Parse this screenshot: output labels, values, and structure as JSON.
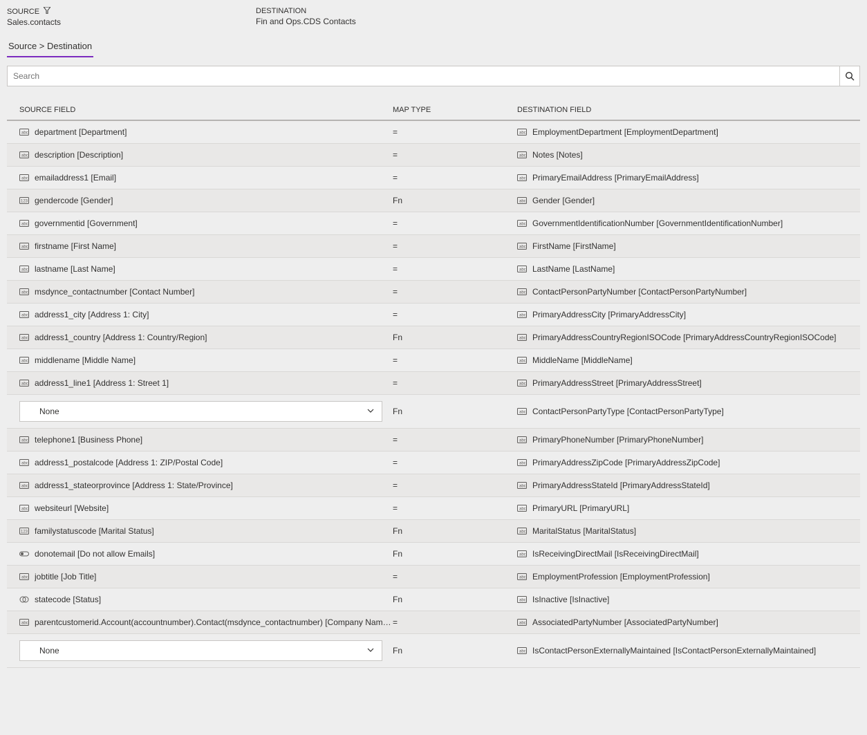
{
  "header": {
    "source_label": "SOURCE",
    "source_value": "Sales.contacts",
    "dest_label": "DESTINATION",
    "dest_value": "Fin and Ops.CDS Contacts"
  },
  "tab": {
    "label": "Source > Destination"
  },
  "search": {
    "placeholder": "Search"
  },
  "columns": {
    "source": "SOURCE FIELD",
    "map": "MAP TYPE",
    "dest": "DESTINATION FIELD"
  },
  "none_label": "None",
  "rows": [
    {
      "src_icon": "field",
      "src": "department [Department]",
      "map": "=",
      "dst_icon": "field",
      "dst": "EmploymentDepartment [EmploymentDepartment]"
    },
    {
      "src_icon": "field",
      "src": "description [Description]",
      "map": "=",
      "dst_icon": "field",
      "dst": "Notes [Notes]"
    },
    {
      "src_icon": "field",
      "src": "emailaddress1 [Email]",
      "map": "=",
      "dst_icon": "field",
      "dst": "PrimaryEmailAddress [PrimaryEmailAddress]"
    },
    {
      "src_icon": "option",
      "src": "gendercode [Gender]",
      "map": "Fn",
      "dst_icon": "field",
      "dst": "Gender [Gender]"
    },
    {
      "src_icon": "field",
      "src": "governmentid [Government]",
      "map": "=",
      "dst_icon": "field",
      "dst": "GovernmentIdentificationNumber [GovernmentIdentificationNumber]"
    },
    {
      "src_icon": "field",
      "src": "firstname [First Name]",
      "map": "=",
      "dst_icon": "field",
      "dst": "FirstName [FirstName]"
    },
    {
      "src_icon": "field",
      "src": "lastname [Last Name]",
      "map": "=",
      "dst_icon": "field",
      "dst": "LastName [LastName]"
    },
    {
      "src_icon": "field",
      "src": "msdynce_contactnumber [Contact Number]",
      "map": "=",
      "dst_icon": "field",
      "dst": "ContactPersonPartyNumber [ContactPersonPartyNumber]"
    },
    {
      "src_icon": "field",
      "src": "address1_city [Address 1: City]",
      "map": "=",
      "dst_icon": "field",
      "dst": "PrimaryAddressCity [PrimaryAddressCity]"
    },
    {
      "src_icon": "field",
      "src": "address1_country [Address 1: Country/Region]",
      "map": "Fn",
      "dst_icon": "field",
      "dst": "PrimaryAddressCountryRegionISOCode [PrimaryAddressCountryRegionISOCode]"
    },
    {
      "src_icon": "field",
      "src": "middlename [Middle Name]",
      "map": "=",
      "dst_icon": "field",
      "dst": "MiddleName [MiddleName]"
    },
    {
      "src_icon": "field",
      "src": "address1_line1 [Address 1: Street 1]",
      "map": "=",
      "dst_icon": "field",
      "dst": "PrimaryAddressStreet [PrimaryAddressStreet]"
    },
    {
      "src_icon": "select",
      "src_select_bind": "none_label",
      "map": "Fn",
      "dst_icon": "field",
      "dst": "ContactPersonPartyType [ContactPersonPartyType]"
    },
    {
      "src_icon": "field",
      "src": "telephone1 [Business Phone]",
      "map": "=",
      "dst_icon": "field",
      "dst": "PrimaryPhoneNumber [PrimaryPhoneNumber]"
    },
    {
      "src_icon": "field",
      "src": "address1_postalcode [Address 1: ZIP/Postal Code]",
      "map": "=",
      "dst_icon": "field",
      "dst": "PrimaryAddressZipCode [PrimaryAddressZipCode]"
    },
    {
      "src_icon": "field",
      "src": "address1_stateorprovince [Address 1: State/Province]",
      "map": "=",
      "dst_icon": "field",
      "dst": "PrimaryAddressStateId [PrimaryAddressStateId]"
    },
    {
      "src_icon": "field",
      "src": "websiteurl [Website]",
      "map": "=",
      "dst_icon": "field",
      "dst": "PrimaryURL [PrimaryURL]"
    },
    {
      "src_icon": "option",
      "src": "familystatuscode [Marital Status]",
      "map": "Fn",
      "dst_icon": "field",
      "dst": "MaritalStatus [MaritalStatus]"
    },
    {
      "src_icon": "toggle",
      "src": "donotemail [Do not allow Emails]",
      "map": "Fn",
      "dst_icon": "field",
      "dst": "IsReceivingDirectMail [IsReceivingDirectMail]"
    },
    {
      "src_icon": "field",
      "src": "jobtitle [Job Title]",
      "map": "=",
      "dst_icon": "field",
      "dst": "EmploymentProfession [EmploymentProfession]"
    },
    {
      "src_icon": "status",
      "src": "statecode [Status]",
      "map": "Fn",
      "dst_icon": "field",
      "dst": "IsInactive [IsInactive]"
    },
    {
      "src_icon": "field",
      "src": "parentcustomerid.Account(accountnumber).Contact(msdynce_contactnumber) [Company Name (Account ...",
      "map": "=",
      "dst_icon": "field",
      "dst": "AssociatedPartyNumber [AssociatedPartyNumber]"
    },
    {
      "src_icon": "select",
      "src_select_bind": "none_label",
      "map": "Fn",
      "dst_icon": "field",
      "dst": "IsContactPersonExternallyMaintained [IsContactPersonExternallyMaintained]"
    }
  ]
}
